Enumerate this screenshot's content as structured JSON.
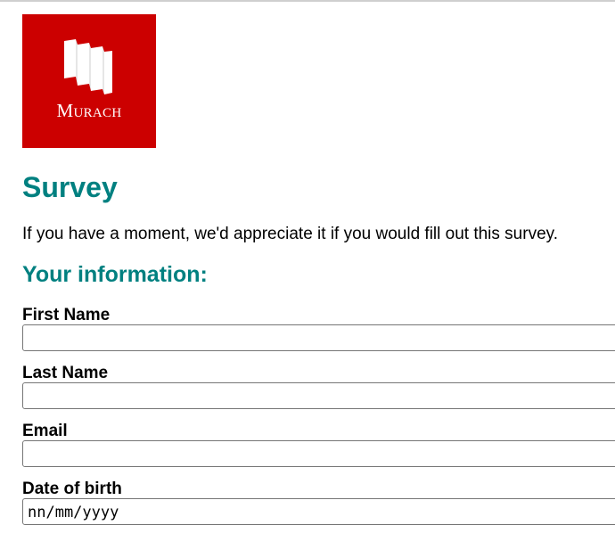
{
  "logo": {
    "text": "Murach",
    "icon": "murach-logo-icon",
    "background_color": "#cc0000"
  },
  "header": {
    "title": "Survey",
    "intro": "If you have a moment, we'd appreciate it if you would fill out this survey."
  },
  "section": {
    "title": "Your information:"
  },
  "fields": {
    "first_name": {
      "label": "First Name",
      "value": ""
    },
    "last_name": {
      "label": "Last Name",
      "value": ""
    },
    "email": {
      "label": "Email",
      "value": ""
    },
    "dob": {
      "label": "Date of birth",
      "value": "nn/mm/yyyy"
    }
  },
  "colors": {
    "heading": "#008080",
    "logo_red": "#cc0000"
  }
}
